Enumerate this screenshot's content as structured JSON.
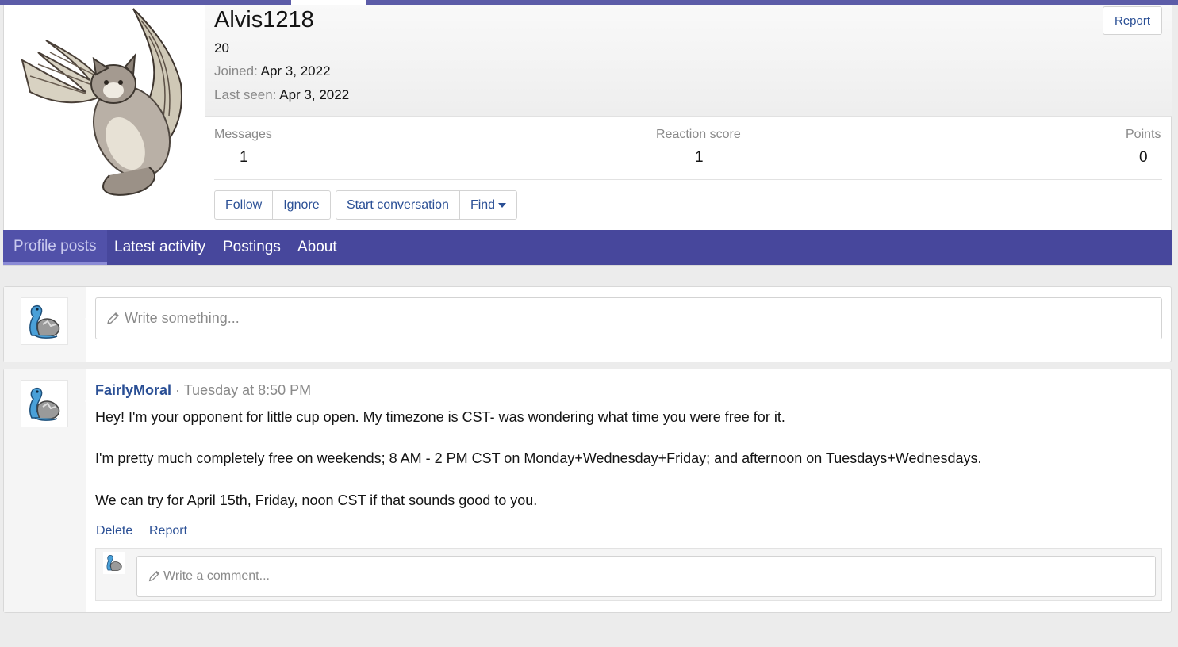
{
  "profile": {
    "username": "Alvis1218",
    "title": "20",
    "joined_label": "Joined:",
    "joined_value": "Apr 3, 2022",
    "last_seen_label": "Last seen:",
    "last_seen_value": "Apr 3, 2022",
    "report_label": "Report",
    "stats": {
      "messages_label": "Messages",
      "messages_value": "1",
      "reaction_label": "Reaction score",
      "reaction_value": "1",
      "points_label": "Points",
      "points_value": "0"
    },
    "buttons": {
      "follow": "Follow",
      "ignore": "Ignore",
      "start_conversation": "Start conversation",
      "find": "Find"
    }
  },
  "tabs": [
    {
      "label": "Profile posts",
      "active": true
    },
    {
      "label": "Latest activity",
      "active": false
    },
    {
      "label": "Postings",
      "active": false
    },
    {
      "label": "About",
      "active": false
    }
  ],
  "composer": {
    "placeholder": "Write something..."
  },
  "post": {
    "author": "FairlyMoral",
    "separator": "·",
    "time": "Tuesday at 8:50 PM",
    "lines": [
      "Hey! I'm your opponent for little cup open. My timezone is CST- was wondering what time you were free for it.",
      "I'm pretty much completely free on weekends; 8 AM - 2 PM CST on Monday+Wednesday+Friday; and afternoon on Tuesdays+Wednesdays.",
      "We can try for April 15th, Friday, noon CST if that sounds good to you."
    ],
    "actions": {
      "delete": "Delete",
      "report": "Report"
    },
    "comment_placeholder": "Write a comment..."
  },
  "colors": {
    "accent": "#47479c",
    "link": "#2a4f95",
    "muted": "#8a8a8a",
    "background": "#ececec"
  },
  "icons": {
    "pencil": "pencil-icon",
    "caret": "caret-down-icon"
  }
}
